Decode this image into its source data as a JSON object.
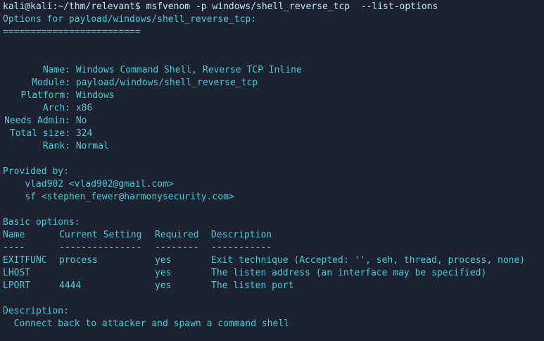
{
  "prompt": "kali@kali:~/thm/relevant$",
  "command": "msfvenom -p windows/shell_reverse_tcp  --list-options",
  "options_header": "Options for payload/windows/shell_reverse_tcp:",
  "options_rule": "=========================",
  "info": [
    {
      "key": "Name:",
      "value": "Windows Command Shell, Reverse TCP Inline"
    },
    {
      "key": "Module:",
      "value": "payload/windows/shell_reverse_tcp"
    },
    {
      "key": "Platform:",
      "value": "Windows"
    },
    {
      "key": "Arch:",
      "value": "x86"
    },
    {
      "key": "Needs Admin:",
      "value": "No"
    },
    {
      "key": "Total size:",
      "value": "324"
    },
    {
      "key": "Rank:",
      "value": "Normal"
    }
  ],
  "provided_by_header": "Provided by:",
  "authors": [
    "vlad902 <vlad902@gmail.com>",
    "sf <stephen_fewer@harmonysecurity.com>"
  ],
  "basic_options_header": "Basic options:",
  "table": {
    "headers": [
      "Name",
      "Current Setting",
      "Required",
      "Description"
    ],
    "rules": [
      "----",
      "---------------",
      "--------",
      "-----------"
    ],
    "rows": [
      [
        "EXITFUNC",
        "process",
        "yes",
        "Exit technique (Accepted: '', seh, thread, process, none)"
      ],
      [
        "LHOST",
        "",
        "yes",
        "The listen address (an interface may be specified)"
      ],
      [
        "LPORT",
        "4444",
        "yes",
        "The listen port"
      ]
    ]
  },
  "description_header": "Description:",
  "description": "  Connect back to attacker and spawn a command shell",
  "colors": {
    "background": "#1c2230",
    "text": "#51c7d7",
    "prompt": "#bfe7ef"
  }
}
